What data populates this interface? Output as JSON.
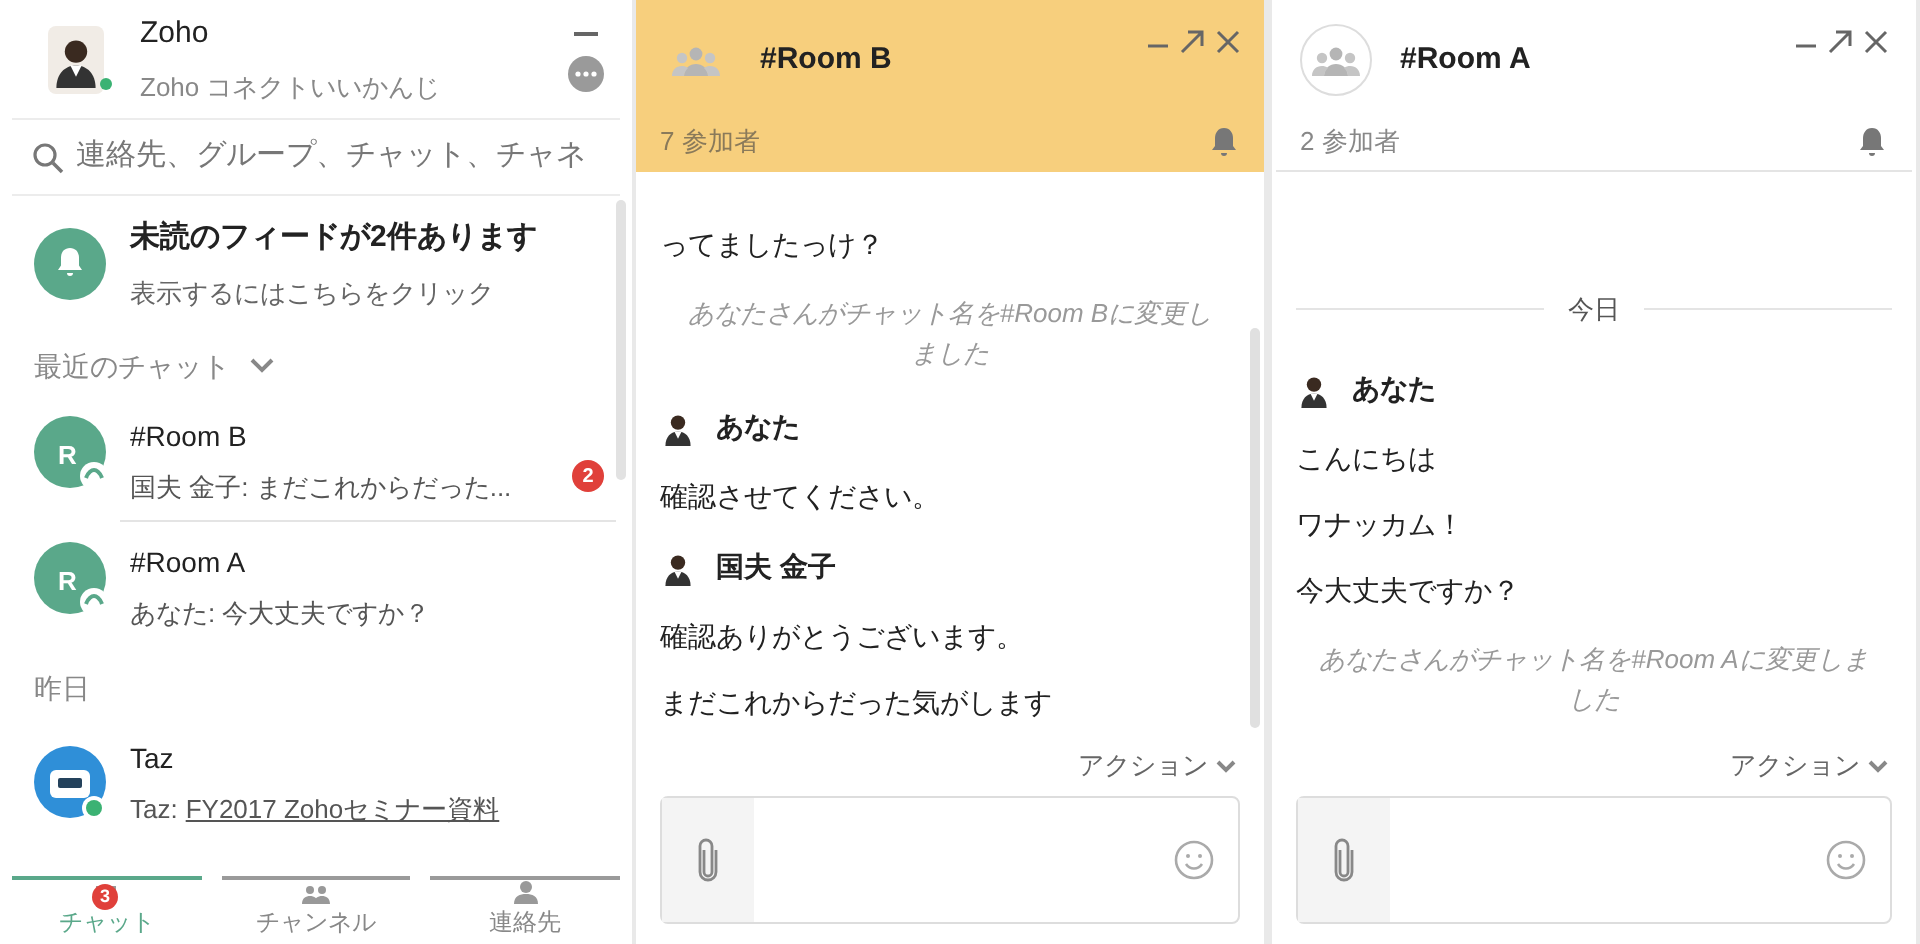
{
  "sidebar": {
    "user": {
      "name": "Zoho",
      "status_text": "Zoho コネクトいいかんじ",
      "online": true
    },
    "search": {
      "placeholder": "連絡先、グループ、チャット、チャネ"
    },
    "feed_notice": {
      "title": "未読のフィードが2件あります",
      "subtitle": "表示するにはこちらをクリック"
    },
    "sections": [
      {
        "title": "最近のチャット",
        "collapsible": true,
        "items": [
          {
            "kind": "group",
            "avatar_letter": "R",
            "name": "#Room B",
            "preview": "国夫 金子: まだこれからだった...",
            "unread": "2"
          },
          {
            "kind": "group",
            "avatar_letter": "R",
            "name": "#Room A",
            "preview": "あなた: 今大丈夫ですか？"
          }
        ]
      },
      {
        "title": "昨日",
        "collapsible": false,
        "items": [
          {
            "kind": "bot",
            "name": "Taz",
            "preview_prefix": "Taz:",
            "preview_link": "FY2017 Zohoセミナー資料"
          }
        ]
      }
    ],
    "tabs": [
      {
        "label": "チャット",
        "selected": true,
        "badge": "3"
      },
      {
        "label": "チャンネル",
        "selected": false
      },
      {
        "label": "連絡先",
        "selected": false
      }
    ]
  },
  "chat_windows": [
    {
      "title": "#Room B",
      "participants": "7 参加者",
      "highlighted": true,
      "messages": [
        {
          "kind": "text",
          "text": "ってましたっけ？"
        },
        {
          "kind": "system",
          "text": "あなたさんがチャット名を#Room Bに変更しました"
        },
        {
          "kind": "sender",
          "name": "あなた"
        },
        {
          "kind": "text",
          "text": "確認させてください。"
        },
        {
          "kind": "sender",
          "name": "国夫 金子"
        },
        {
          "kind": "text",
          "text": "確認ありがとうございます。"
        },
        {
          "kind": "text",
          "text": "まだこれからだった気がします"
        }
      ],
      "action_label": "アクション"
    },
    {
      "title": "#Room A",
      "participants": "2 参加者",
      "highlighted": false,
      "messages": [
        {
          "kind": "date",
          "text": "今日"
        },
        {
          "kind": "sender",
          "name": "あなた"
        },
        {
          "kind": "text",
          "text": "こんにちは"
        },
        {
          "kind": "text",
          "text": "ワナッカム！"
        },
        {
          "kind": "text",
          "text": "今大丈夫ですか？"
        },
        {
          "kind": "system",
          "text": "あなたさんがチャット名を#Room Aに変更しました"
        }
      ],
      "action_label": "アクション"
    }
  ]
}
